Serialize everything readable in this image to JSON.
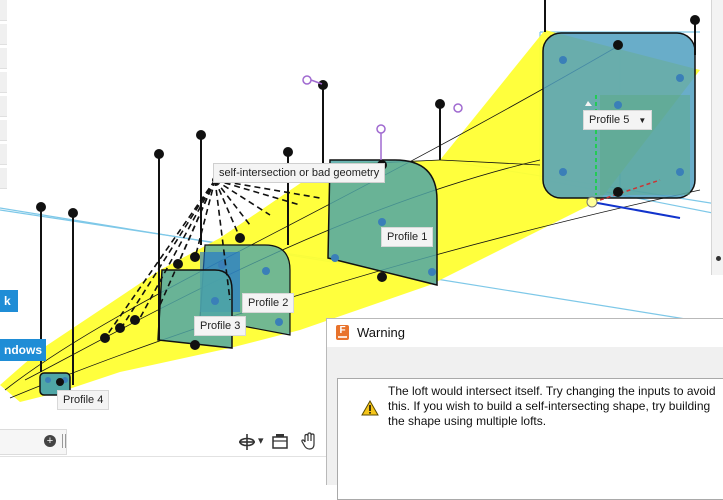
{
  "canvas": {
    "error_tooltip": "self-intersection or bad geometry",
    "profiles": [
      {
        "label": "Profile 1"
      },
      {
        "label": "Profile 2"
      },
      {
        "label": "Profile 3"
      },
      {
        "label": "Profile 4"
      },
      {
        "label": "Profile 5",
        "has_dropdown": true
      }
    ],
    "dropdown_glyph": "▼"
  },
  "left_panel": {
    "tab_1": "k",
    "tab_2": "ndows"
  },
  "nav_toolbar": {
    "icons": [
      "orbit-icon",
      "display-settings-icon",
      "pan-icon"
    ],
    "caret": "▾"
  },
  "warning_dialog": {
    "title": "Warning",
    "app_icon_letter": "F",
    "message": "The loft would intersect itself. Try changing the inputs to avoid this. If you wish to build a self-intersecting shape, try building the shape using multiple lofts."
  },
  "colors": {
    "loft_preview": "#ffff33",
    "profile_fill": "#4fa6a6",
    "profile5_fill": "#4f9fbf",
    "accent": "#1f8dd6",
    "warning_app_icon": "#e8732c"
  }
}
